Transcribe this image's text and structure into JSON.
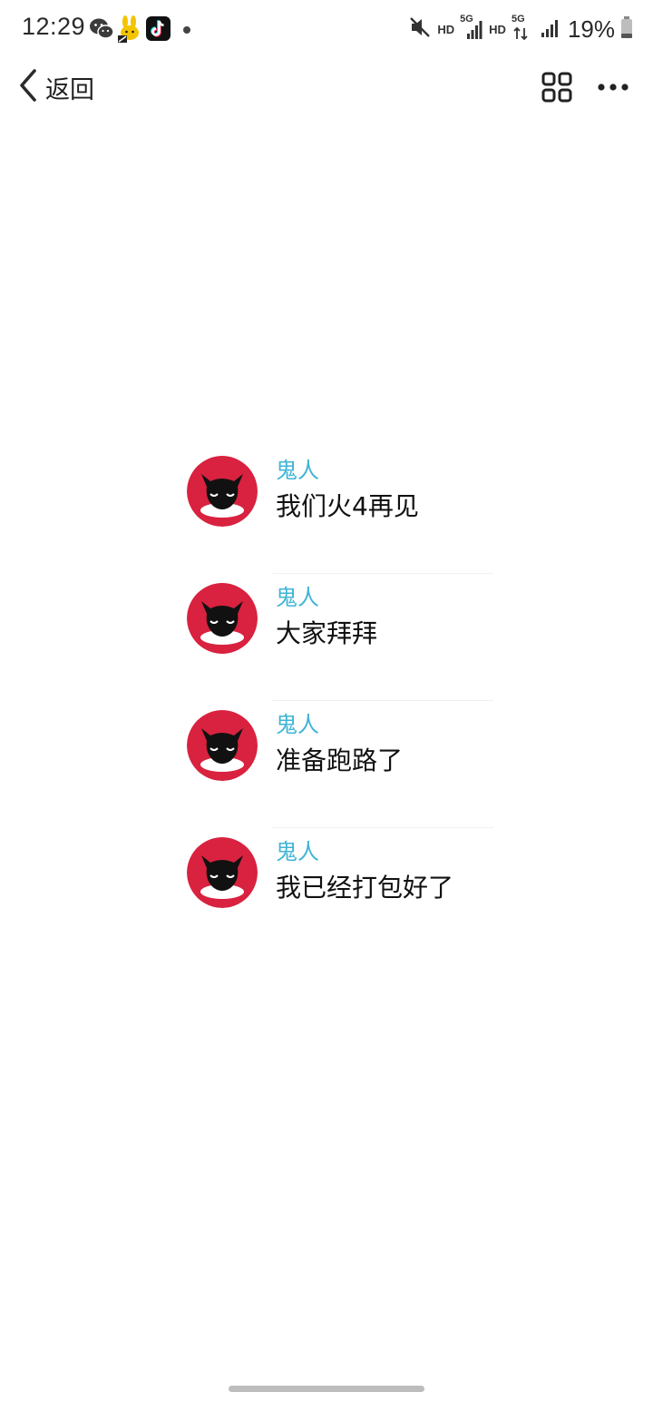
{
  "status_bar": {
    "time": "12:29",
    "hd_label_1": "HD",
    "network_1": "5G",
    "hd_label_2": "HD",
    "network_2": "5G",
    "battery": "19%",
    "icons": [
      "wechat-icon",
      "rabbit-app-icon",
      "tiktok-icon",
      "notification-dot",
      "mute-icon",
      "signal-icon",
      "signal-icon",
      "battery-icon"
    ]
  },
  "nav": {
    "back_label": "返回",
    "icons": [
      "back-chevron-icon",
      "grid-icon",
      "more-icon"
    ]
  },
  "messages": [
    {
      "sender": "鬼人",
      "text": "我们火4再见"
    },
    {
      "sender": "鬼人",
      "text": "大家拜拜"
    },
    {
      "sender": "鬼人",
      "text": "准备跑路了"
    },
    {
      "sender": "鬼人",
      "text": "我已经打包好了"
    }
  ],
  "colors": {
    "sender_name": "#3fb4d6",
    "avatar_bg": "#d8223f",
    "text": "#111111"
  }
}
